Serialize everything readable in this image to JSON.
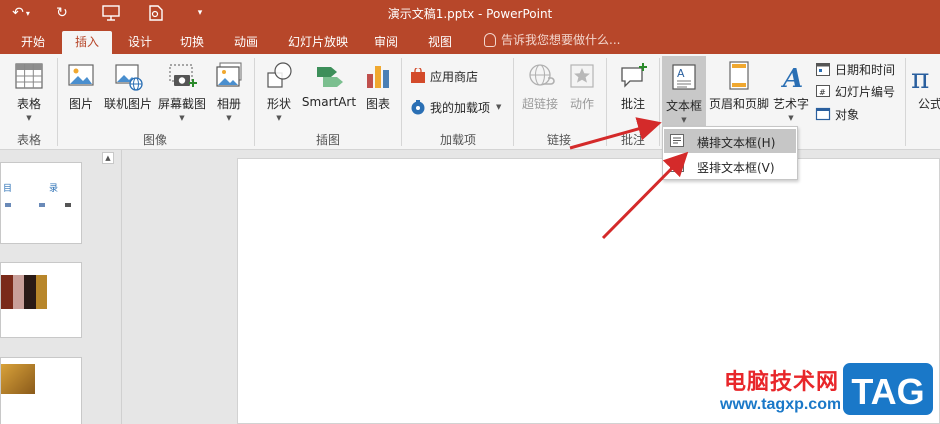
{
  "window": {
    "title": "演示文稿1.pptx - PowerPoint"
  },
  "tabs": [
    "开始",
    "插入",
    "设计",
    "切换",
    "动画",
    "幻灯片放映",
    "审阅",
    "视图"
  ],
  "tell_me": "告诉我您想要做什么...",
  "ribbon": {
    "table": {
      "btn": "表格",
      "group": "表格"
    },
    "images": {
      "picture": "图片",
      "online_picture": "联机图片",
      "screenshot": "屏幕截图",
      "album": "相册",
      "group": "图像"
    },
    "illustrations": {
      "shapes": "形状",
      "smartart": "SmartArt",
      "chart": "图表",
      "group": "插图"
    },
    "addins": {
      "store": "应用商店",
      "my_addins": "我的加载项",
      "group": "加载项"
    },
    "links": {
      "hyperlink": "超链接",
      "action": "动作",
      "group": "链接"
    },
    "comments": {
      "comment": "批注",
      "group": "批注"
    },
    "text": {
      "textbox": "文本框",
      "header_footer": "页眉和页脚",
      "wordart": "艺术字",
      "date_time": "日期和时间",
      "slide_number": "幻灯片编号",
      "object": "对象"
    },
    "symbols": {
      "equation": "公式"
    }
  },
  "dropdown": {
    "items": [
      "横排文本框(H)",
      "竖排文本框(V)"
    ]
  },
  "thumbs": {
    "t1_text": [
      "目",
      "录"
    ]
  },
  "watermark": {
    "name": "电脑技术网",
    "url": "www.tagxp.com",
    "logo": "TAG"
  },
  "colors": {
    "accent": "#b7472a",
    "arrow": "#d42a2a"
  }
}
